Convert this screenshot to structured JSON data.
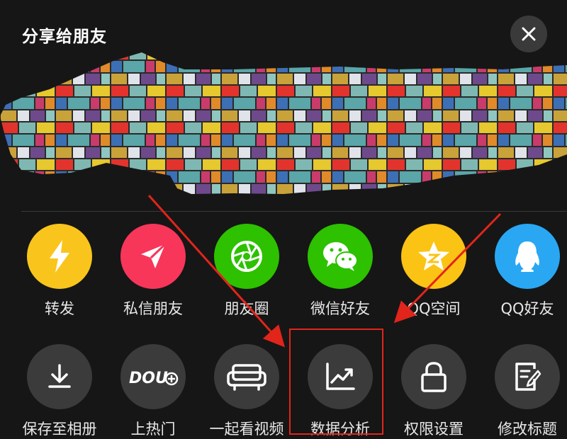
{
  "header": {
    "title": "分享给朋友"
  },
  "share_items": [
    {
      "label": "转发",
      "icon": "lightning-icon",
      "color": "#f9c51c"
    },
    {
      "label": "私信朋友",
      "icon": "paper-plane-icon",
      "color": "#f7365a"
    },
    {
      "label": "朋友圈",
      "icon": "moments-shutter-icon",
      "color": "#2dc100"
    },
    {
      "label": "微信好友",
      "icon": "wechat-icon",
      "color": "#2dc100"
    },
    {
      "label": "QQ空间",
      "icon": "qzone-star-icon",
      "color": "#fbc314"
    },
    {
      "label": "QQ好友",
      "icon": "qq-penguin-icon",
      "color": "#29a7f3"
    }
  ],
  "action_items": [
    {
      "label": "保存至相册",
      "icon": "download-icon"
    },
    {
      "label": "上热门",
      "icon": "dou-plus-icon",
      "icon_text": "DOU"
    },
    {
      "label": "一起看视频",
      "icon": "sofa-icon"
    },
    {
      "label": "数据分析",
      "icon": "trend-chart-icon"
    },
    {
      "label": "权限设置",
      "icon": "lock-icon"
    },
    {
      "label": "修改标题",
      "icon": "edit-document-icon"
    }
  ],
  "annotation": {
    "color": "#e1251b"
  }
}
